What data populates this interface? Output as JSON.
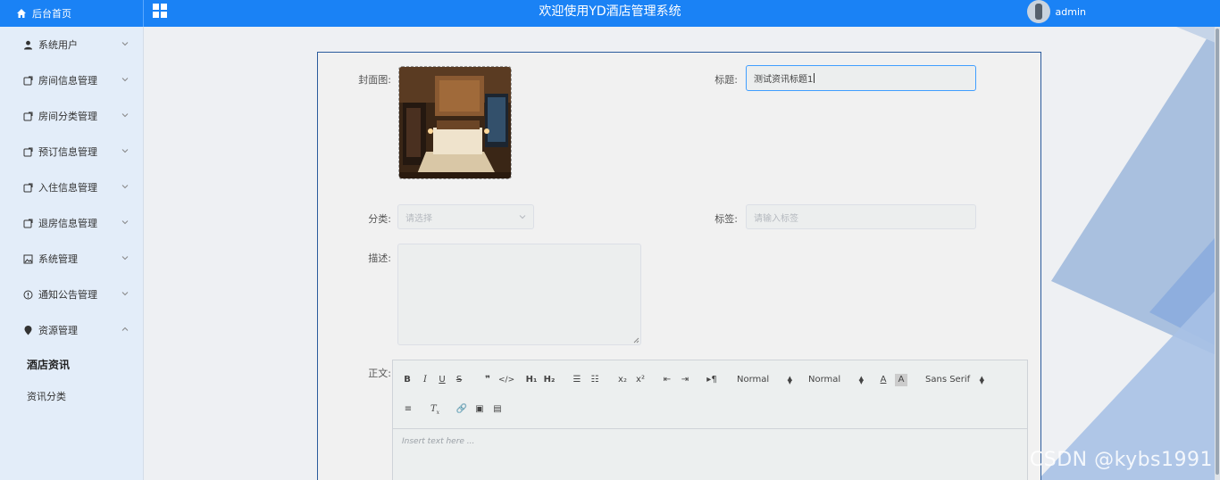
{
  "header": {
    "home_label": "后台首页",
    "app_title": "欢迎使用YD酒店管理系统",
    "username": "admin"
  },
  "sidebar": {
    "items": [
      {
        "label": "系统用户",
        "icon": "user-icon"
      },
      {
        "label": "房间信息管理",
        "icon": "document-icon"
      },
      {
        "label": "房间分类管理",
        "icon": "document-icon"
      },
      {
        "label": "预订信息管理",
        "icon": "document-icon"
      },
      {
        "label": "入住信息管理",
        "icon": "document-icon"
      },
      {
        "label": "退房信息管理",
        "icon": "document-icon"
      },
      {
        "label": "系统管理",
        "icon": "picture-icon"
      },
      {
        "label": "通知公告管理",
        "icon": "info-circle-icon"
      },
      {
        "label": "资源管理",
        "icon": "location-pin-icon",
        "expanded": true
      }
    ],
    "subitems": [
      {
        "label": "酒店资讯",
        "active": true
      },
      {
        "label": "资讯分类",
        "active": false
      }
    ]
  },
  "form": {
    "cover_label": "封面图:",
    "title_label": "标题:",
    "title_value": "测试资讯标题1",
    "category_label": "分类:",
    "category_placeholder": "请选择",
    "tags_label": "标签:",
    "tags_placeholder": "请输入标签",
    "description_label": "描述:",
    "content_label": "正文:"
  },
  "editor": {
    "header_picker": "Normal",
    "size_picker": "Normal",
    "font_picker": "Sans Serif",
    "placeholder": "Insert text here ..."
  },
  "watermark": "CSDN @kybs1991",
  "colors": {
    "header_blue": "#1a82f5",
    "sidebar_bg": "#e3edf9",
    "focus_border": "#409eff",
    "card_border": "#2a5b9c"
  }
}
